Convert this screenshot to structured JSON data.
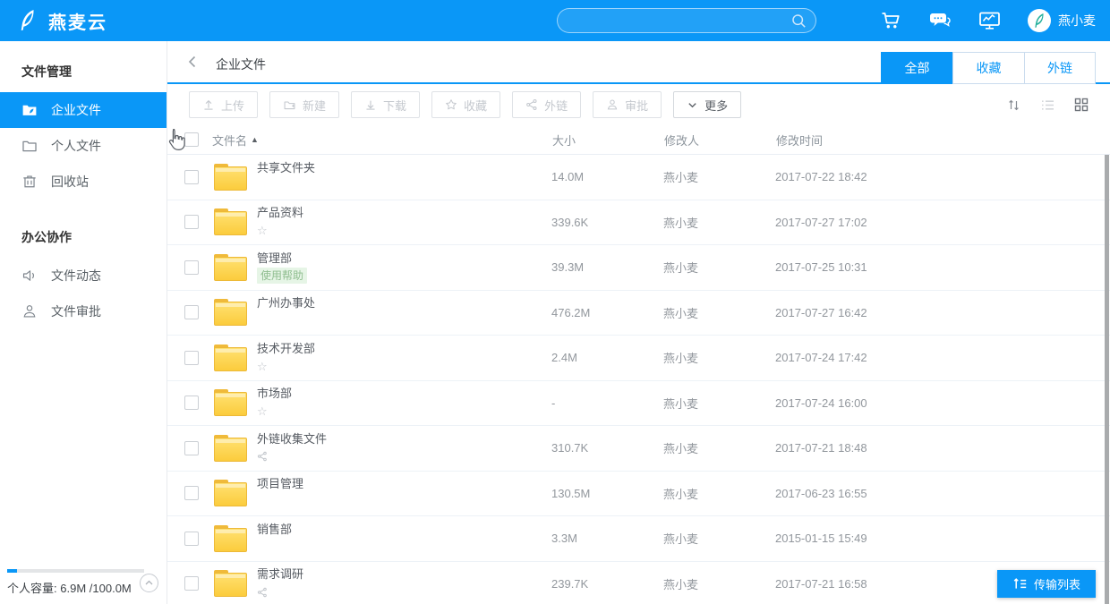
{
  "app": {
    "accent_color": "#0a97f7",
    "folder_color": "#fbcc3d",
    "tag_bg": "#e6f5e6",
    "tag_text_color": "#8fbd8f"
  },
  "header": {
    "logo_text": "燕麦云",
    "logo_icon": "leaf-logo-icon",
    "search": {
      "value": "",
      "icon": "search-icon"
    },
    "icons": [
      "cart-icon",
      "chat-icon",
      "monitor-chart-icon"
    ],
    "user_name": "燕小麦",
    "avatar_icon": "leaf-avatar-icon"
  },
  "sidebar": {
    "sections": [
      {
        "title": "文件管理",
        "items": [
          {
            "label": "企业文件",
            "icon": "enterprise-folder-icon",
            "active": true
          },
          {
            "label": "个人文件",
            "icon": "personal-folder-icon",
            "active": false
          },
          {
            "label": "回收站",
            "icon": "trash-icon",
            "active": false
          }
        ]
      },
      {
        "title": "办公协作",
        "items": [
          {
            "label": "文件动态",
            "icon": "activity-speaker-icon",
            "active": false
          },
          {
            "label": "文件审批",
            "icon": "approval-person-icon",
            "active": false
          }
        ]
      }
    ],
    "storage": {
      "label": "个人容量:",
      "used": "6.9M",
      "separator": " /",
      "total": "100.0M",
      "percent": 7,
      "collapse_icon": "chevron-up-icon"
    }
  },
  "breadcrumb": {
    "back_icon": "back-arrow-icon",
    "title": "企业文件"
  },
  "tabs": [
    {
      "label": "全部",
      "active": true
    },
    {
      "label": "收藏",
      "active": false
    },
    {
      "label": "外链",
      "active": false
    }
  ],
  "toolbar": {
    "buttons": [
      {
        "label": "上传",
        "icon": "upload-icon",
        "enabled": false
      },
      {
        "label": "新建",
        "icon": "new-folder-icon",
        "enabled": false
      },
      {
        "label": "下载",
        "icon": "download-icon",
        "enabled": false
      },
      {
        "label": "收藏",
        "icon": "star-icon",
        "enabled": false
      },
      {
        "label": "外链",
        "icon": "share-icon",
        "enabled": false
      },
      {
        "label": "审批",
        "icon": "approval-icon",
        "enabled": false
      },
      {
        "label": "更多",
        "icon": "chevron-down-icon",
        "enabled": true
      }
    ],
    "view_icons": [
      "sort-icon",
      "list-view-icon",
      "grid-view-icon"
    ]
  },
  "table": {
    "columns": {
      "name": "文件名",
      "size": "大小",
      "modifier": "修改人",
      "modified": "修改时间"
    },
    "sort_indicator": "▲",
    "star_glyph": "☆",
    "rows": [
      {
        "name": "共享文件夹",
        "badge": null,
        "size": "14.0M",
        "modifier": "燕小麦",
        "modified": "2017-07-22 18:42"
      },
      {
        "name": "产品资料",
        "badge": "star",
        "size": "339.6K",
        "modifier": "燕小麦",
        "modified": "2017-07-27 17:02"
      },
      {
        "name": "管理部",
        "badge": "tag",
        "tag_text": "使用帮助",
        "size": "39.3M",
        "modifier": "燕小麦",
        "modified": "2017-07-25 10:31"
      },
      {
        "name": "广州办事处",
        "badge": null,
        "size": "476.2M",
        "modifier": "燕小麦",
        "modified": "2017-07-27 16:42"
      },
      {
        "name": "技术开发部",
        "badge": "star",
        "size": "2.4M",
        "modifier": "燕小麦",
        "modified": "2017-07-24 17:42"
      },
      {
        "name": "市场部",
        "badge": "star",
        "size": "-",
        "modifier": "燕小麦",
        "modified": "2017-07-24 16:00"
      },
      {
        "name": "外链收集文件",
        "badge": "share",
        "size": "310.7K",
        "modifier": "燕小麦",
        "modified": "2017-07-21 18:48"
      },
      {
        "name": "项目管理",
        "badge": null,
        "size": "130.5M",
        "modifier": "燕小麦",
        "modified": "2017-06-23 16:55"
      },
      {
        "name": "销售部",
        "badge": null,
        "size": "3.3M",
        "modifier": "燕小麦",
        "modified": "2015-01-15 15:49"
      },
      {
        "name": "需求调研",
        "badge": "share",
        "size": "239.7K",
        "modifier": "燕小麦",
        "modified": "2017-07-21 16:58"
      }
    ]
  },
  "transfer_button": {
    "label": "传输列表",
    "icon": "transfer-list-icon"
  }
}
